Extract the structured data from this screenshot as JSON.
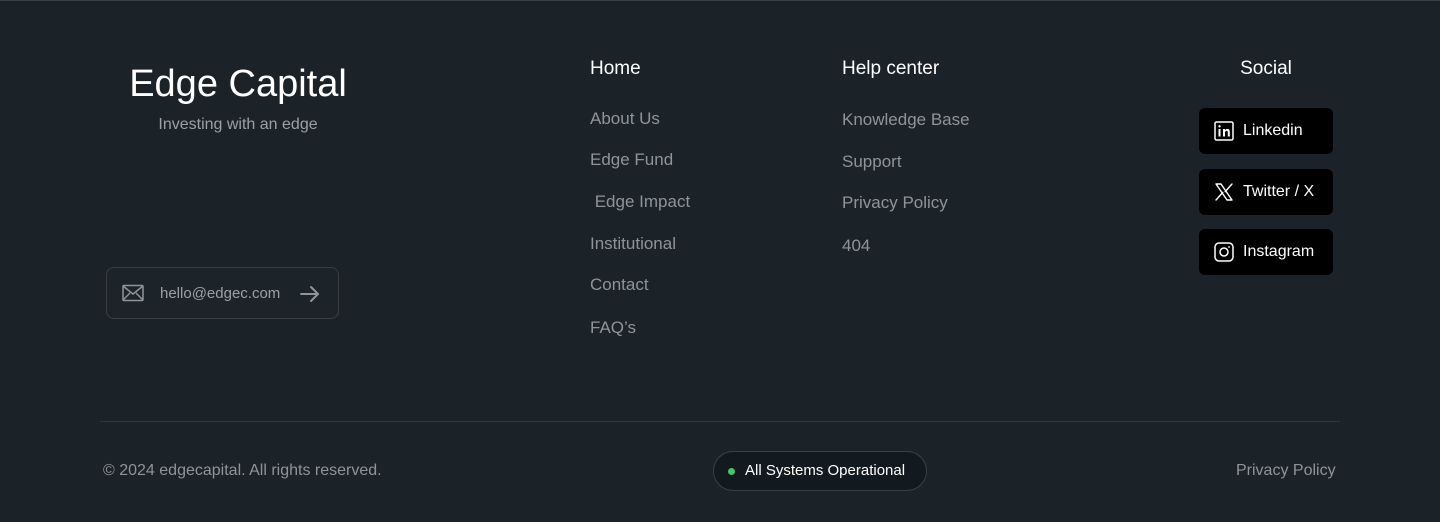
{
  "brand": {
    "name": "Edge Capital",
    "tagline": "Investing with an edge"
  },
  "newsletter": {
    "email": "hello@edgec.com",
    "icon": "mail-icon",
    "submit_icon": "arrow-right-icon"
  },
  "home": {
    "heading": "Home",
    "links": [
      "About Us",
      "Edge Fund",
      " Edge Impact",
      "Institutional",
      "Contact",
      "FAQ’s"
    ]
  },
  "help": {
    "heading": "Help center",
    "links": [
      "Knowledge Base",
      "Support",
      "Privacy Policy",
      "404"
    ]
  },
  "social": {
    "heading": "Social",
    "buttons": [
      {
        "label": "Linkedin",
        "icon": "linkedin-icon"
      },
      {
        "label": "Twitter / X",
        "icon": "x-icon"
      },
      {
        "label": "Instagram",
        "icon": "instagram-icon"
      }
    ]
  },
  "bottom": {
    "copyright": "© 2024 edgecapital. All rights reserved.",
    "status": "All Systems Operational",
    "status_color": "#3ec86a",
    "privacy": "Privacy Policy"
  },
  "colors": {
    "background": "#1b2228",
    "muted_text": "#8e949a",
    "button_bg": "#000000"
  }
}
